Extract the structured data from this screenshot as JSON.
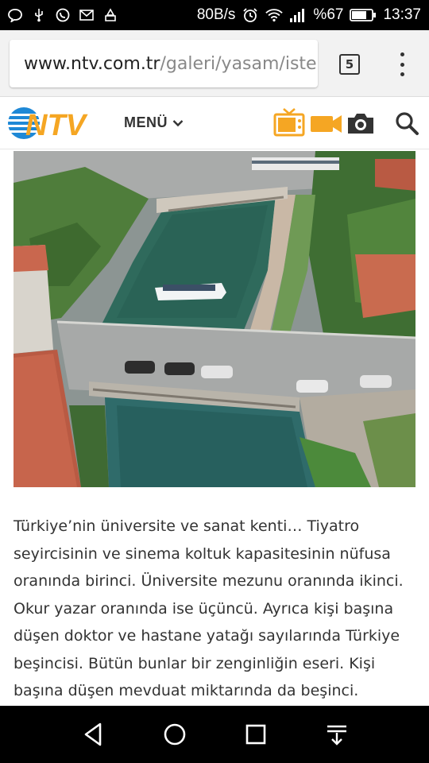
{
  "status_bar": {
    "speed": "80B/s",
    "battery": "%67",
    "time": "13:37",
    "icons": [
      "message-icon",
      "usb-icon",
      "whatsapp-icon",
      "mail-icon",
      "notification-icon",
      "alarm-icon",
      "wifi-icon",
      "signal-icon",
      "battery-icon"
    ]
  },
  "browser": {
    "url_host": "www.ntv.com.tr",
    "url_path": "/galeri/yasam/iste",
    "tab_count": "5"
  },
  "header": {
    "logo_text": "NTV",
    "menu_label": "MENÜ",
    "icons": [
      "tv-icon",
      "video-camera-icon",
      "photo-camera-icon",
      "search-icon"
    ],
    "accent_color": "#f5a623",
    "logo_blue": "#1e88d6"
  },
  "article": {
    "paragraph": "Türkiye’nin üniversite ve sanat kenti… Tiyatro seyircisinin ve sinema koltuk kapasitesinin nüfusa oranında birinci. Üniversite mezunu oranında ikinci. Okur yazar oranında ise üçüncü. Ayrıca kişi başına düşen doktor ve hastane yatağı sayılarında Türkiye beşincisi. Bütün bunlar bir zenginliğin eseri. Kişi başına düşen mevduat miktarında da beşinci."
  },
  "nav_bar": {
    "icons": [
      "back-icon",
      "home-icon",
      "recents-icon",
      "notification-pull-icon"
    ]
  }
}
